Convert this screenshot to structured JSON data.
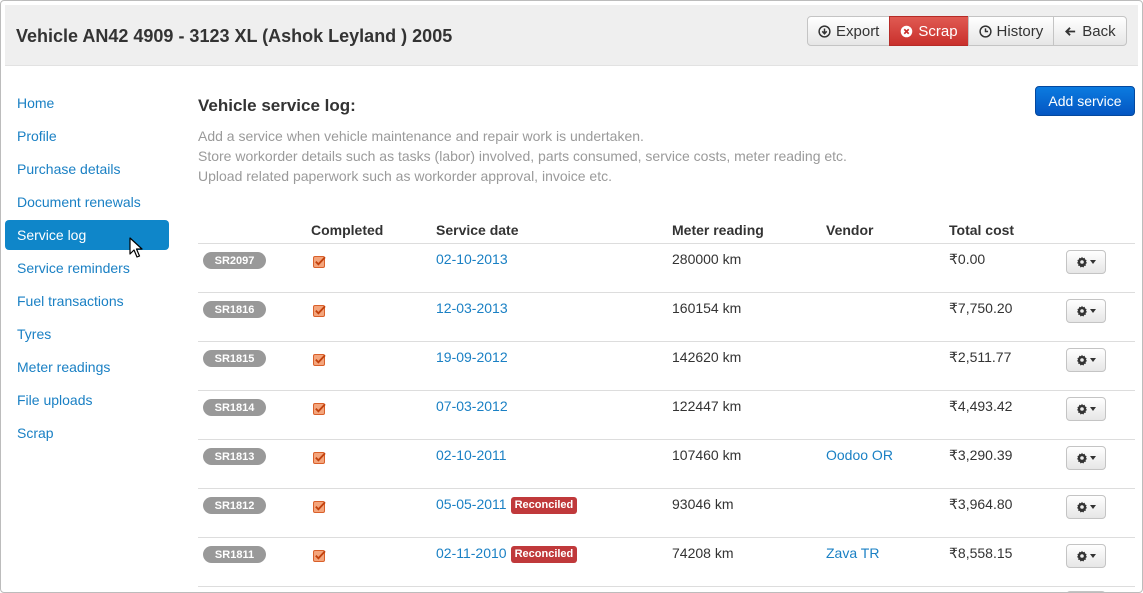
{
  "header": {
    "title": "Vehicle AN42 4909 - 3123 XL (Ashok Leyland ) 2005",
    "buttons": [
      {
        "label": "Export",
        "icon": "circle-arrow-down-icon"
      },
      {
        "label": "Scrap",
        "icon": "circle-x-icon"
      },
      {
        "label": "History",
        "icon": "clock-icon"
      },
      {
        "label": "Back",
        "icon": "arrow-left-icon"
      }
    ]
  },
  "sidebar": {
    "items": [
      {
        "label": "Home"
      },
      {
        "label": "Profile"
      },
      {
        "label": "Purchase details"
      },
      {
        "label": "Document renewals"
      },
      {
        "label": "Service log",
        "active": true
      },
      {
        "label": "Service reminders"
      },
      {
        "label": "Fuel transactions"
      },
      {
        "label": "Tyres"
      },
      {
        "label": "Meter readings"
      },
      {
        "label": "File uploads"
      },
      {
        "label": "Scrap"
      }
    ]
  },
  "main": {
    "title": "Vehicle service log:",
    "add_button": "Add service",
    "description": [
      "Add a service when vehicle maintenance and repair work is undertaken.",
      "Store workorder details such as tasks (labor) involved, parts consumed, service costs, meter reading etc.",
      "Upload related paperwork such as workorder approval, invoice etc."
    ]
  },
  "table": {
    "columns": [
      "",
      "Completed",
      "Service date",
      "Meter reading",
      "Vendor",
      "Total cost"
    ],
    "reconciled_label": "Reconciled",
    "rows": [
      {
        "id": "SR2097",
        "completed": true,
        "date": "02-10-2013",
        "reconciled": false,
        "meter": "280000 km",
        "vendor": "",
        "cost": "₹0.00"
      },
      {
        "id": "SR1816",
        "completed": true,
        "date": "12-03-2013",
        "reconciled": false,
        "meter": "160154 km",
        "vendor": "",
        "cost": "₹7,750.20"
      },
      {
        "id": "SR1815",
        "completed": true,
        "date": "19-09-2012",
        "reconciled": false,
        "meter": "142620 km",
        "vendor": "",
        "cost": "₹2,511.77"
      },
      {
        "id": "SR1814",
        "completed": true,
        "date": "07-03-2012",
        "reconciled": false,
        "meter": "122447 km",
        "vendor": "",
        "cost": "₹4,493.42"
      },
      {
        "id": "SR1813",
        "completed": true,
        "date": "02-10-2011",
        "reconciled": false,
        "meter": "107460 km",
        "vendor": "Oodoo OR",
        "cost": "₹3,290.39"
      },
      {
        "id": "SR1812",
        "completed": true,
        "date": "05-05-2011",
        "reconciled": true,
        "meter": "93046 km",
        "vendor": "",
        "cost": "₹3,964.80"
      },
      {
        "id": "SR1811",
        "completed": true,
        "date": "02-11-2010",
        "reconciled": true,
        "meter": "74208 km",
        "vendor": "Zava TR",
        "cost": "₹8,558.15"
      }
    ]
  },
  "colors": {
    "link": "#1a80c4",
    "active_nav": "#0f86c9",
    "danger": "#c9302c",
    "primary": "#0456c2",
    "badge": "#999999",
    "reconciled": "#c0393b",
    "checkbox": "#e8703a"
  }
}
